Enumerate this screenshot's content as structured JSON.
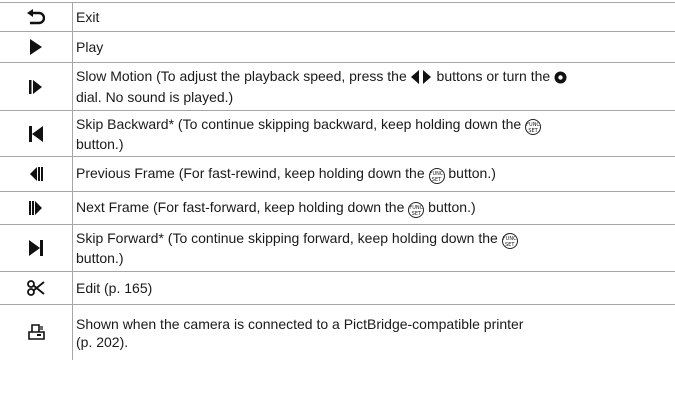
{
  "rows": [
    {
      "icon": "exit-icon",
      "text": "Exit"
    },
    {
      "icon": "play-icon",
      "text": "Play"
    },
    {
      "icon": "slow-motion-icon",
      "pre": "Slow Motion (To adjust the playback speed, press the ",
      "mid": " buttons or turn the ",
      "post": "dial. No sound is played.)"
    },
    {
      "icon": "skip-backward-icon",
      "pre": "Skip Backward* (To continue skipping backward, keep holding down the ",
      "post": "button.)"
    },
    {
      "icon": "previous-frame-icon",
      "pre": "Previous Frame (For fast-rewind, keep holding down the ",
      "post": " button.)"
    },
    {
      "icon": "next-frame-icon",
      "pre": "Next Frame (For fast-forward, keep holding down the ",
      "post": " button.)"
    },
    {
      "icon": "skip-forward-icon",
      "pre": "Skip Forward* (To continue skipping forward, keep holding down the ",
      "post": "button.)"
    },
    {
      "icon": "edit-scissors-icon",
      "text": "Edit (p. 165)"
    },
    {
      "icon": "print-icon",
      "line1": "Shown when the camera is connected to a PictBridge-compatible printer",
      "line2": "(p. 202)."
    }
  ],
  "func_button_label": {
    "top": "FUNC",
    "bottom": "SET"
  }
}
